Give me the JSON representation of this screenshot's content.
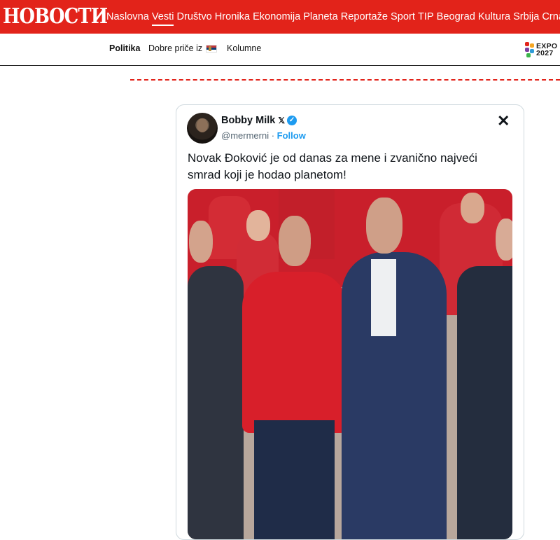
{
  "site": {
    "logo": "НОВОСТИ"
  },
  "main_nav": [
    {
      "label": "Naslovna",
      "active": false
    },
    {
      "label": "Vesti",
      "active": true
    },
    {
      "label": "Društvo",
      "active": false
    },
    {
      "label": "Hronika",
      "active": false
    },
    {
      "label": "Ekonomija",
      "active": false
    },
    {
      "label": "Planeta",
      "active": false
    },
    {
      "label": "Reportaže",
      "active": false
    },
    {
      "label": "Sport",
      "active": false
    },
    {
      "label": "TIP",
      "active": false
    },
    {
      "label": "Beograd",
      "active": false
    },
    {
      "label": "Kultura",
      "active": false
    },
    {
      "label": "Srbija",
      "active": false
    },
    {
      "label": "Crna G",
      "active": false
    }
  ],
  "sub_nav": {
    "politika": "Politika",
    "dobre_price": "Dobre priče iz",
    "kolumne": "Kolumne"
  },
  "expo_badge": {
    "line1": "EXPO",
    "line2": "2027"
  },
  "tweet": {
    "display_name": "Bobby Milk",
    "handle": "@mermerni",
    "separator": " · ",
    "follow_label": "Follow",
    "text": "Novak Đoković je od danas za mene i zvanično najveći smrad koji je hodao planetom!"
  },
  "colors": {
    "brand_red": "#e2231a",
    "link_blue": "#1d9bf0"
  },
  "icons": {
    "verified": "verified-badge-icon",
    "x": "x-logo-icon",
    "flag": "serbia-flag-icon"
  }
}
